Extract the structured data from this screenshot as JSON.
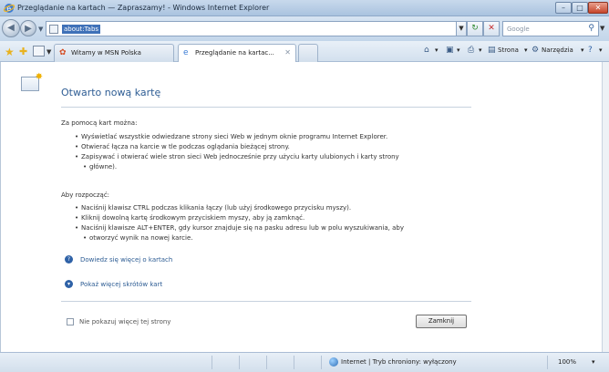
{
  "window": {
    "title": "Przeglądanie na kartach — Zapraszamy! - Windows Internet Explorer"
  },
  "address_bar": {
    "url": "about:Tabs"
  },
  "search": {
    "placeholder": "Google"
  },
  "tabs": [
    {
      "label": "Witamy w MSN Polska",
      "active": false
    },
    {
      "label": "Przeglądanie na kartac...",
      "active": true
    },
    {
      "label": "",
      "active": false
    }
  ],
  "command_bar": {
    "page_label": "Strona",
    "tools_label": "Narzędzia"
  },
  "content": {
    "heading": "Otwarto nową kartę",
    "section1_title": "Za pomocą kart można:",
    "section1_items": [
      "Wyświetlać wszystkie odwiedzane strony sieci Web w jednym oknie programu Internet Explorer.",
      "Otwierać łącza na karcie w tle podczas oglądania bieżącej strony.",
      "Zapisywać i otwierać wiele stron sieci Web jednocześnie przy użyciu karty ulubionych i karty strony",
      "główne)."
    ],
    "section2_title": "Aby rozpocząć:",
    "section2_items": [
      "Naciśnij klawisz CTRL podczas klikania łączy (lub użyj środkowego przycisku myszy).",
      "Kliknij dowolną kartę środkowym przyciskiem myszy, aby ją zamknąć.",
      "Naciśnij klawisze ALT+ENTER, gdy kursor znajduje się na pasku adresu lub w polu wyszukiwania, aby",
      "otworzyć wynik na nowej karcie."
    ],
    "link_learn_more": "Dowiedz się więcej o kartach",
    "link_shortcuts": "Pokaż więcej skrótów kart",
    "dont_show_label": "Nie pokazuj więcej tej strony",
    "close_button": "Zamknij"
  },
  "status_bar": {
    "zone_text": "Internet | Tryb chroniony: wyłączony",
    "zoom": "100%"
  },
  "colors": {
    "link": "#2e5d94",
    "heading": "#2e5d94"
  }
}
